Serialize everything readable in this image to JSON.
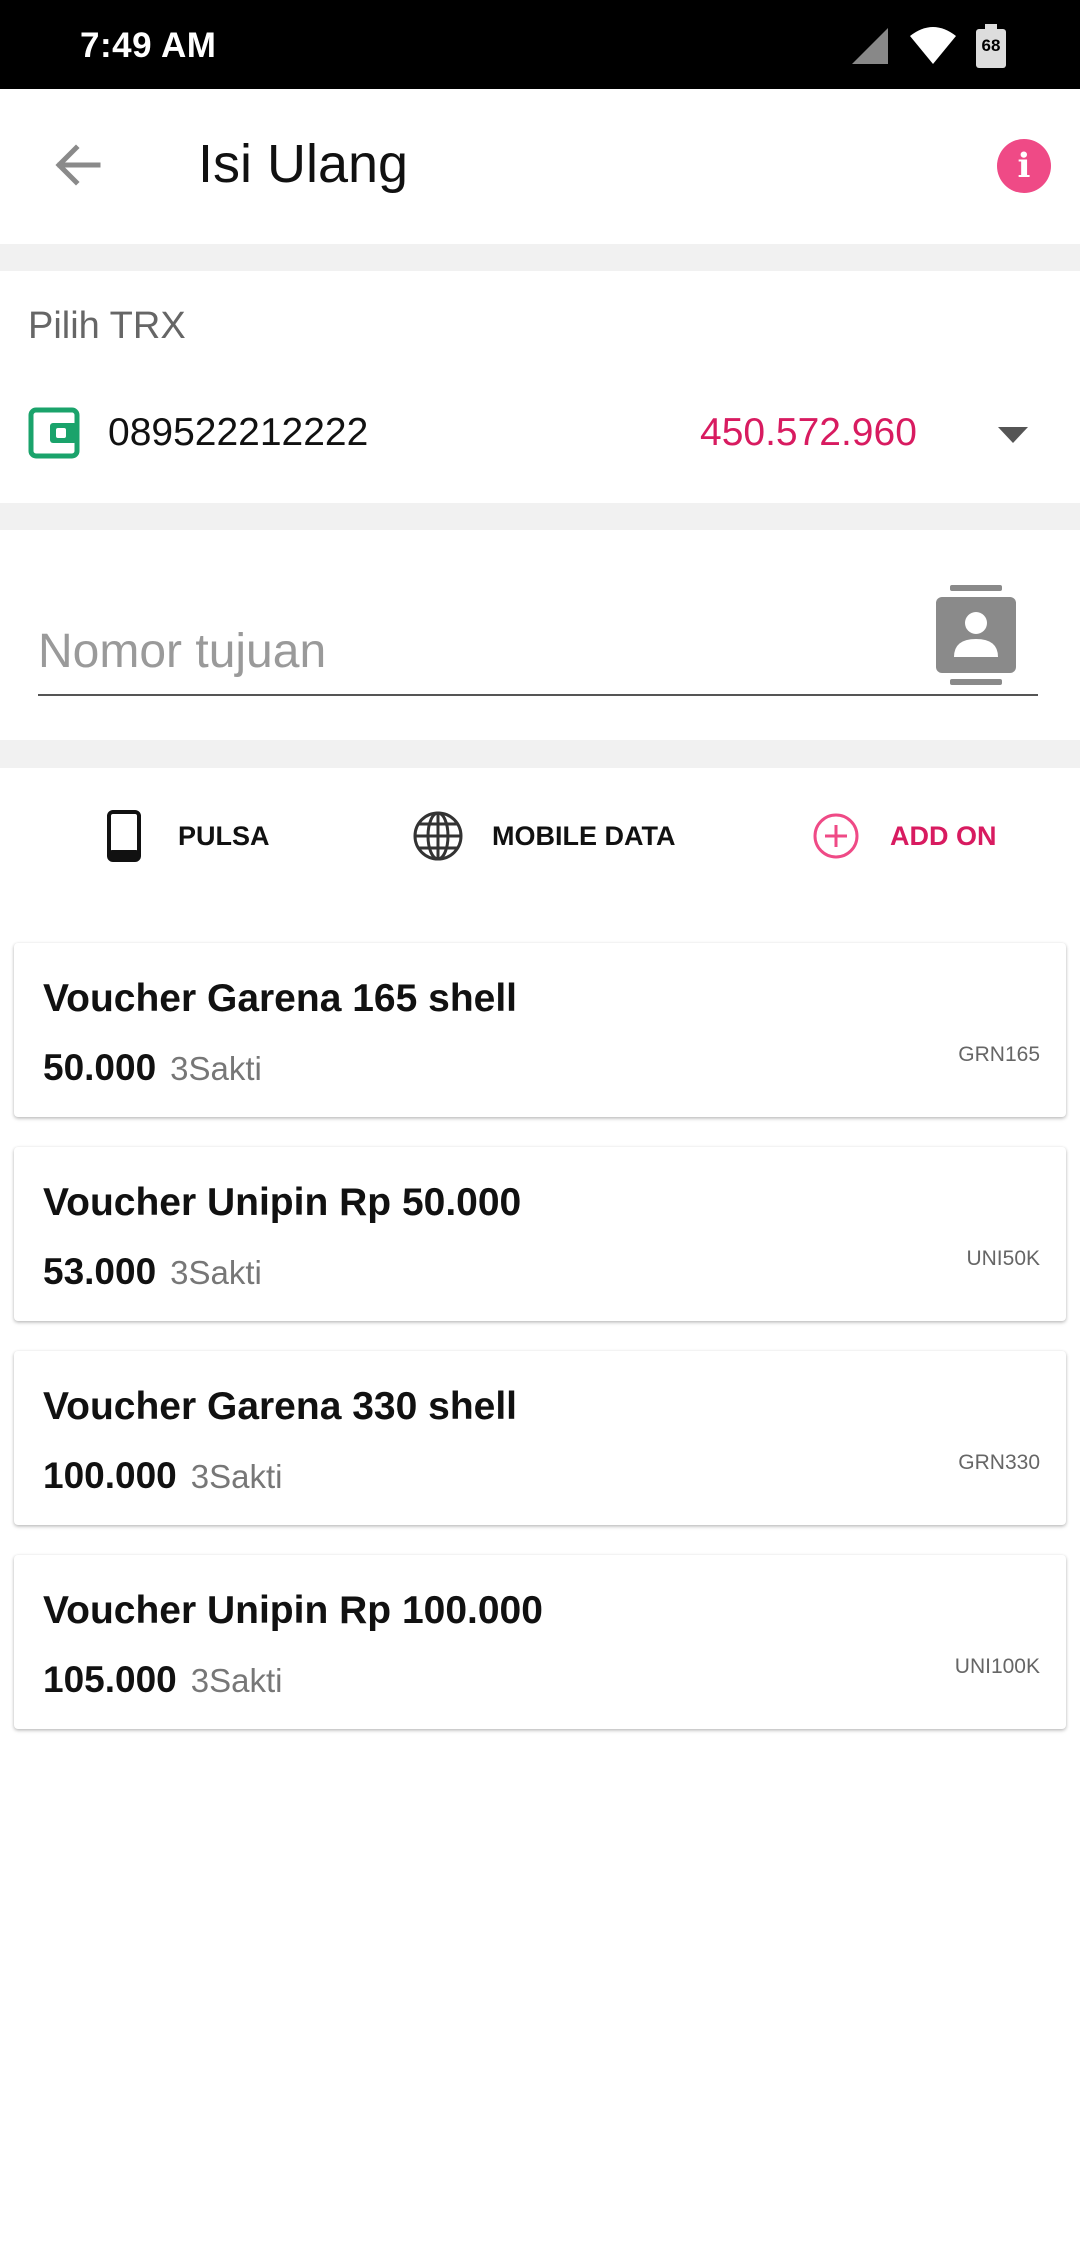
{
  "status_bar": {
    "time": "7:49 AM",
    "battery": "68"
  },
  "app_bar": {
    "title": "Isi Ulang",
    "info_icon": "i"
  },
  "trx": {
    "label": "Pilih TRX",
    "number": "089522212222",
    "balance": "450.572.960"
  },
  "destination": {
    "placeholder": "Nomor tujuan",
    "value": ""
  },
  "tabs": [
    {
      "label": "PULSA",
      "icon": "phone-icon"
    },
    {
      "label": "MOBILE DATA",
      "icon": "globe-icon"
    },
    {
      "label": "ADD ON",
      "icon": "add-circle-icon",
      "active": true
    }
  ],
  "products": [
    {
      "name": "Voucher Garena 165 shell",
      "price": "50.000",
      "vendor": "3Sakti",
      "code": "GRN165"
    },
    {
      "name": "Voucher Unipin Rp 50.000",
      "price": "53.000",
      "vendor": "3Sakti",
      "code": "UNI50K"
    },
    {
      "name": "Voucher Garena 330 shell",
      "price": "100.000",
      "vendor": "3Sakti",
      "code": "GRN330"
    },
    {
      "name": "Voucher Unipin Rp 100.000",
      "price": "105.000",
      "vendor": "3Sakti",
      "code": "UNI100K"
    }
  ],
  "colors": {
    "accent": "#d81b60",
    "info": "#ef4a86",
    "wallet": "#1aa36b"
  }
}
